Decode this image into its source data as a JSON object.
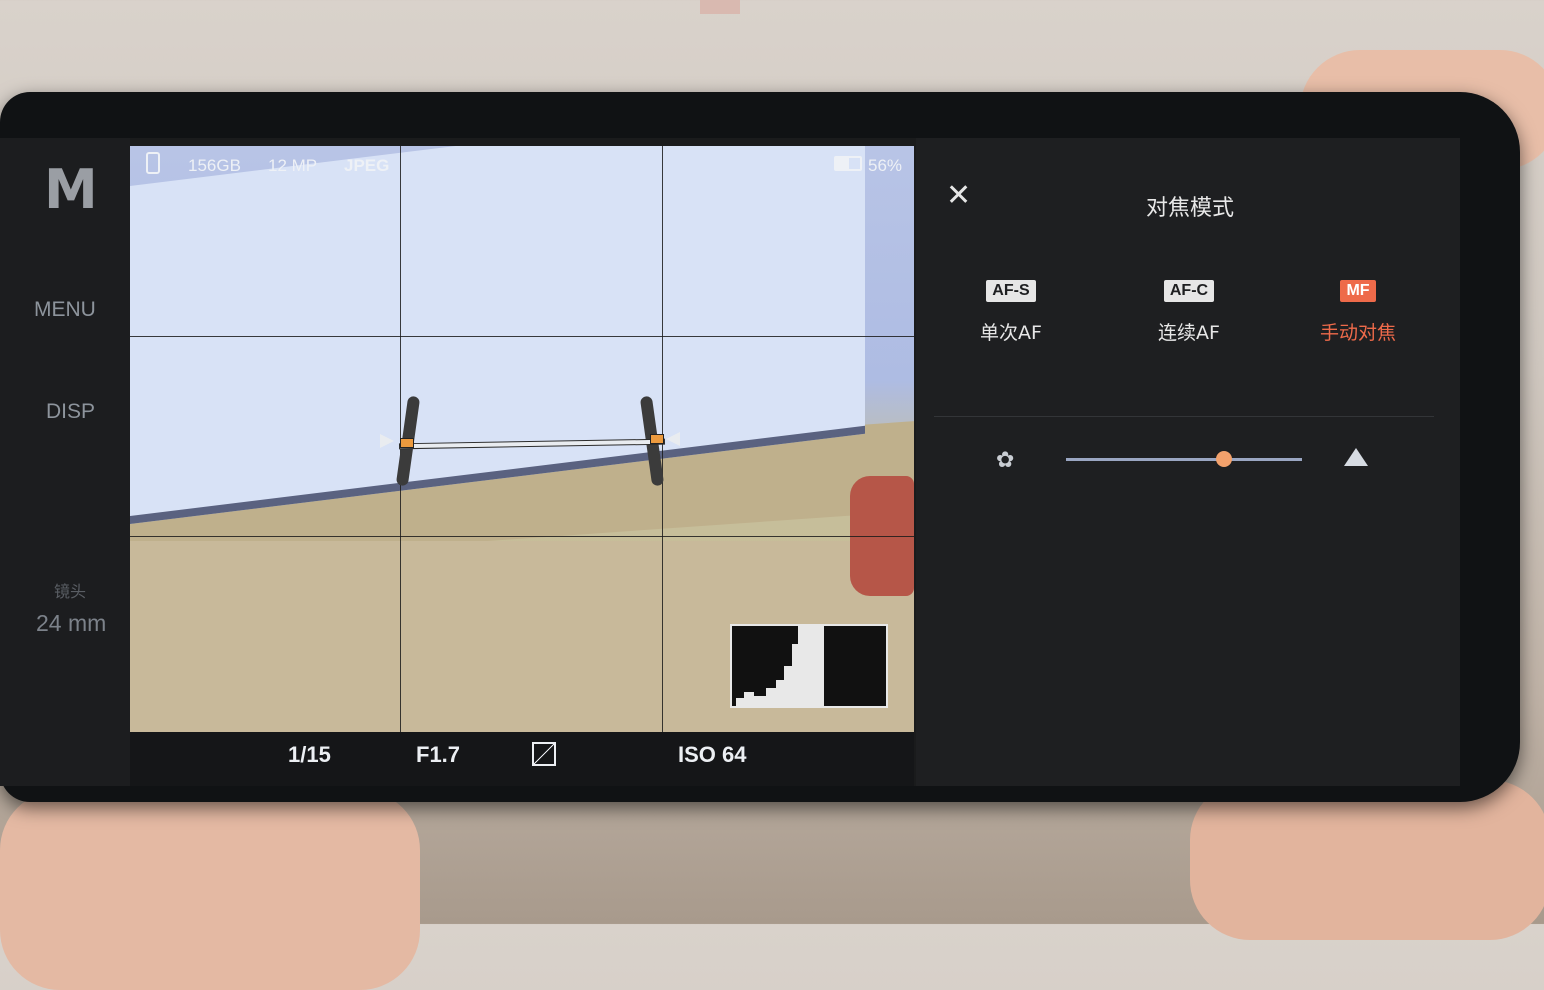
{
  "left_panel": {
    "mode": "M",
    "menu_label": "MENU",
    "disp_label": "DISP",
    "lens_label": "镜头",
    "lens_value": "24 mm"
  },
  "status_bar": {
    "storage": "156GB",
    "megapixels": "12 MP",
    "format": "JPEG",
    "battery": "56%",
    "battery_level": 0.56
  },
  "bottom_bar": {
    "shutter": "1/15",
    "aperture": "F1.7",
    "ev_icon": "exposure-compensation-icon",
    "iso": "ISO 64"
  },
  "focus_panel": {
    "title": "对焦模式",
    "close_icon": "close-icon",
    "options": [
      {
        "badge": "AF-S",
        "label": "单次AF",
        "active": false
      },
      {
        "badge": "AF-C",
        "label": "连续AF",
        "active": false
      },
      {
        "badge": "MF",
        "label": "手动对焦",
        "active": true
      }
    ],
    "near_icon": "macro-flower-icon",
    "far_icon": "mountain-icon",
    "focus_distance": 0.67,
    "accent_color": "#ee6a4a"
  }
}
